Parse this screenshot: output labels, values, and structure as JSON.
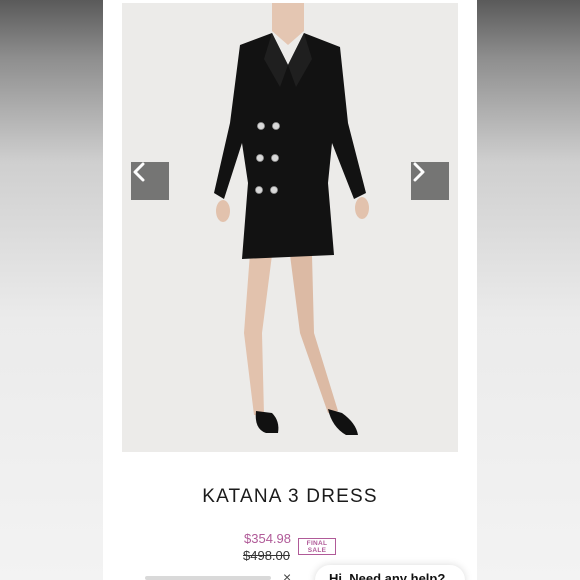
{
  "product": {
    "title": "KATANA 3 DRESS",
    "sale_price": "$354.98",
    "original_price": "$498.00",
    "badge_line1": "FINAL",
    "badge_line2": "SALE"
  },
  "gallery": {
    "prev_icon": "chevron-left-icon",
    "next_icon": "chevron-right-icon"
  },
  "chat": {
    "close_label": "×",
    "prompt": "Hi. Need any help?"
  },
  "colors": {
    "accent": "#b05a98",
    "arrow_bg": "#6b6b6b",
    "photo_bg": "#ecebe9"
  }
}
